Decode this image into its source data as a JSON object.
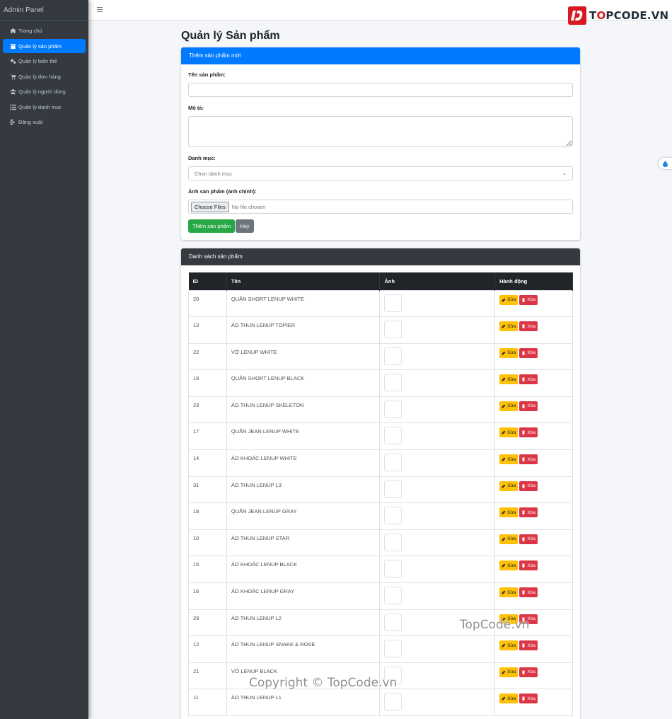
{
  "sidebar": {
    "brand": "Admin Panel",
    "items": [
      {
        "label": "Trang chủ",
        "icon": "home-icon",
        "active": false
      },
      {
        "label": "Quản lý sản phẩm",
        "icon": "box-icon",
        "active": true
      },
      {
        "label": "Quản lý biến thể",
        "icon": "cogs-icon",
        "active": false
      },
      {
        "label": "Quản lý đơn hàng",
        "icon": "cart-icon",
        "active": false
      },
      {
        "label": "Quản lý người dùng",
        "icon": "users-icon",
        "active": false
      },
      {
        "label": "Quản lý danh mục",
        "icon": "list-icon",
        "active": false
      },
      {
        "label": "Đăng xuất",
        "icon": "logout-icon",
        "active": false
      }
    ]
  },
  "header": {
    "logo_prefix": "T",
    "logo_o": "O",
    "logo_suffix": "PCODE.VN"
  },
  "page": {
    "title": "Quản lý Sản phẩm"
  },
  "add_form": {
    "header": "Thêm sản phẩm mới",
    "name_label": "Tên sản phẩm:",
    "name_value": "",
    "desc_label": "Mô tả:",
    "desc_value": "",
    "category_label": "Danh mục:",
    "category_selected": "Chọn danh mục",
    "image_label": "Ảnh sản phẩm (ảnh chính):",
    "file_button": "Choose Files",
    "file_status": "No file chosen",
    "submit_label": "Thêm sản phẩm",
    "cancel_label": "Hủy"
  },
  "product_list": {
    "header": "Danh sách sản phẩm",
    "columns": [
      "ID",
      "Tên",
      "Ảnh",
      "Hành động"
    ],
    "edit_label": "Sửa",
    "delete_label": "Xóa",
    "rows": [
      {
        "id": "20",
        "name": "QUẦN SHORT LENUP WHITE"
      },
      {
        "id": "13",
        "name": "ÁO THUN LENUP TOPIER"
      },
      {
        "id": "22",
        "name": "VỚ LENUP WHITE"
      },
      {
        "id": "19",
        "name": "QUẦN SHORT LENUP BLACK"
      },
      {
        "id": "23",
        "name": "ÁO THUN LENUP SKELETON"
      },
      {
        "id": "17",
        "name": "QUẦN JEAN LENUP WHITE"
      },
      {
        "id": "14",
        "name": "ÁO KHOÁC LENUP WHITE"
      },
      {
        "id": "31",
        "name": "ÁO THUN LENUP L3"
      },
      {
        "id": "18",
        "name": "QUẦN JEAN LENUP GRAY"
      },
      {
        "id": "10",
        "name": "ÁO THUN LENUP STAR"
      },
      {
        "id": "15",
        "name": "ÁO KHOÁC LENUP BLACK"
      },
      {
        "id": "16",
        "name": "ÁO KHOÁC LENUP GRAY"
      },
      {
        "id": "29",
        "name": "ÁO THUN LENUP L2"
      },
      {
        "id": "12",
        "name": "ÁO THUN LENUP SNAKE & ROSE"
      },
      {
        "id": "21",
        "name": "VỚ LENUP BLACK"
      },
      {
        "id": "11",
        "name": "ÁO THUN LENUP L1"
      }
    ]
  },
  "watermarks": {
    "site": "TopCode.vn",
    "copyright": "Copyright © TopCode.vn"
  },
  "colors": {
    "primary": "#007bff",
    "success": "#28a745",
    "warning": "#ffc107",
    "danger": "#dc3545",
    "sidebar": "#343a40"
  }
}
